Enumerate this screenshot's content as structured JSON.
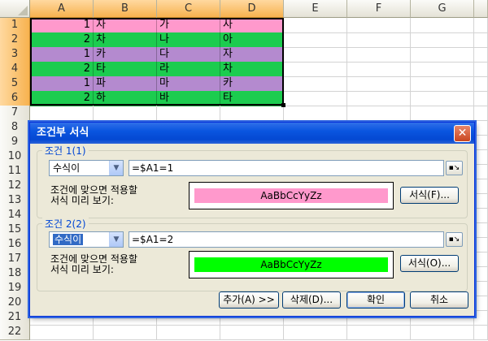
{
  "columns": [
    "A",
    "B",
    "C",
    "D",
    "E",
    "F",
    "G"
  ],
  "rows": [
    "1",
    "2",
    "3",
    "4",
    "5",
    "6",
    "7",
    "8",
    "9",
    "10",
    "11",
    "12",
    "13",
    "14",
    "15",
    "16",
    "17",
    "18",
    "19",
    "20",
    "21",
    "22"
  ],
  "cells": [
    {
      "a": "1",
      "b": "자",
      "c": "가",
      "d": "사",
      "color": "#ff99cc"
    },
    {
      "a": "2",
      "b": "차",
      "c": "나",
      "d": "아",
      "color": "#1ccc4f"
    },
    {
      "a": "1",
      "b": "카",
      "c": "다",
      "d": "자",
      "color": "#b48acf"
    },
    {
      "a": "2",
      "b": "타",
      "c": "라",
      "d": "차",
      "color": "#1ccc4f"
    },
    {
      "a": "1",
      "b": "파",
      "c": "마",
      "d": "카",
      "color": "#b48acf"
    },
    {
      "a": "2",
      "b": "하",
      "c": "바",
      "d": "타",
      "color": "#1ccc4f"
    }
  ],
  "dialog": {
    "title": "조건부 서식",
    "condition1": {
      "title": "조건 1(1)",
      "type": "수식이",
      "formula": "=$A1=1",
      "preview_label_line1": "조건에 맞으면 적용할",
      "preview_label_line2": "서식 미리 보기:",
      "preview_text": "AaBbCcYyZz",
      "preview_color": "#ff99cc",
      "format_button": "서식(F)..."
    },
    "condition2": {
      "title": "조건 2(2)",
      "type": "수식이",
      "formula": "=$A1=2",
      "preview_label_line1": "조건에 맞으면 적용할",
      "preview_label_line2": "서식 미리 보기:",
      "preview_text": "AaBbCcYyZz",
      "preview_color": "#00ff00",
      "format_button": "서식(O)..."
    },
    "buttons": {
      "add": "추가(A) >>",
      "delete": "삭제(D)...",
      "ok": "확인",
      "cancel": "취소"
    }
  },
  "icons": {
    "close": "close-icon",
    "ref": "range-select-icon",
    "dropdown": "chevron-down-icon"
  }
}
